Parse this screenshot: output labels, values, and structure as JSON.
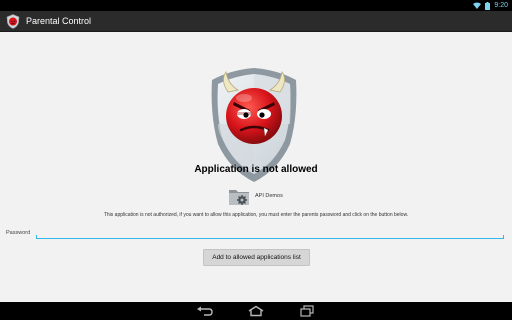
{
  "status_bar": {
    "time": "9:20",
    "icons": [
      "wifi-icon",
      "battery-icon"
    ]
  },
  "action_bar": {
    "title": "Parental Control",
    "icon": "parental-control-devil-icon"
  },
  "main": {
    "logo": "devil-shield-logo",
    "title": "Application is not allowed",
    "app": {
      "icon": "folder-gear-icon",
      "name": "API Demos"
    },
    "info": "This application is not authorized, if you want to allow this application, you must enter the parents password and click on the button below.",
    "password_label": "Password",
    "password_value": "",
    "add_button_label": "Add to allowed applications list"
  },
  "nav_bar": {
    "buttons": [
      "back-icon",
      "home-icon",
      "recent-apps-icon"
    ]
  },
  "colors": {
    "accent": "#33b5e5",
    "action_bar": "#2b2b2b",
    "background": "#f2f2f2",
    "devil_red": "#d8141b"
  }
}
